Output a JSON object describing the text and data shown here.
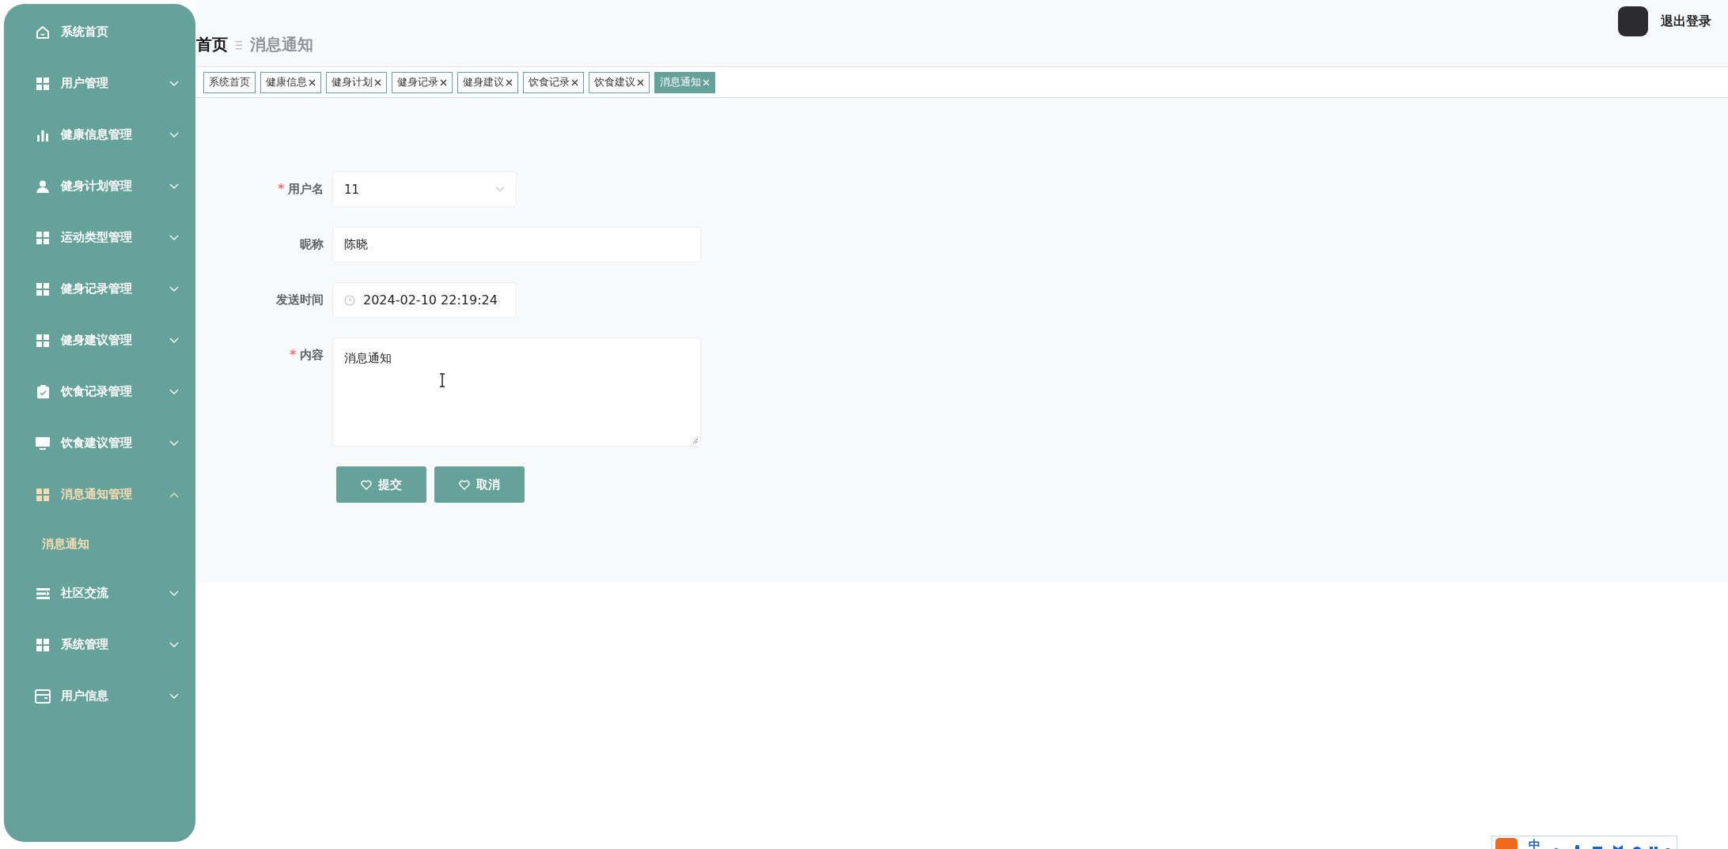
{
  "sidebar": {
    "items": [
      {
        "label": "系统首页",
        "kind": "link",
        "selected": false
      },
      {
        "label": "用户管理",
        "kind": "submenu",
        "expanded": false,
        "selected": false
      },
      {
        "label": "健康信息管理",
        "kind": "submenu",
        "expanded": false,
        "selected": false
      },
      {
        "label": "健身计划管理",
        "kind": "submenu",
        "expanded": false,
        "selected": false
      },
      {
        "label": "运动类型管理",
        "kind": "submenu",
        "expanded": false,
        "selected": false
      },
      {
        "label": "健身记录管理",
        "kind": "submenu",
        "expanded": false,
        "selected": false
      },
      {
        "label": "健身建议管理",
        "kind": "submenu",
        "expanded": false,
        "selected": false
      },
      {
        "label": "饮食记录管理",
        "kind": "submenu",
        "expanded": false,
        "selected": false
      },
      {
        "label": "饮食建议管理",
        "kind": "submenu",
        "expanded": false,
        "selected": false
      },
      {
        "label": "消息通知管理",
        "kind": "submenu",
        "expanded": true,
        "selected": true,
        "children": [
          {
            "label": "消息通知",
            "selected": true
          }
        ]
      },
      {
        "label": "社区交流",
        "kind": "submenu",
        "expanded": false,
        "selected": false
      },
      {
        "label": "系统管理",
        "kind": "submenu",
        "expanded": false,
        "selected": false
      },
      {
        "label": "用户信息",
        "kind": "submenu",
        "expanded": false,
        "selected": false
      }
    ]
  },
  "breadcrumb": [
    "首页",
    "消息通知"
  ],
  "header": {
    "logout": "退出登录"
  },
  "tabs": [
    {
      "label": "系统首页",
      "closable": false,
      "selected": false
    },
    {
      "label": "健康信息",
      "closable": true,
      "selected": false
    },
    {
      "label": "健身计划",
      "closable": true,
      "selected": false
    },
    {
      "label": "健身记录",
      "closable": true,
      "selected": false
    },
    {
      "label": "健身建议",
      "closable": true,
      "selected": false
    },
    {
      "label": "饮食记录",
      "closable": true,
      "selected": false
    },
    {
      "label": "饮食建议",
      "closable": true,
      "selected": false
    },
    {
      "label": "消息通知",
      "closable": true,
      "selected": true
    }
  ],
  "form": {
    "fields": [
      {
        "kind": "select",
        "label": "用户名",
        "required_mark": "*",
        "value": "11"
      },
      {
        "kind": "text",
        "label": "昵称",
        "value": "陈晓"
      },
      {
        "kind": "datetime",
        "label": "发送时间",
        "value": "2024-02-10 22:19:24"
      },
      {
        "kind": "textarea",
        "label": "内容",
        "required_mark": "*",
        "value": "消息通知"
      }
    ],
    "buttons": [
      "提交",
      "取消"
    ]
  },
  "ime_toolbar": {
    "mode": "中"
  }
}
